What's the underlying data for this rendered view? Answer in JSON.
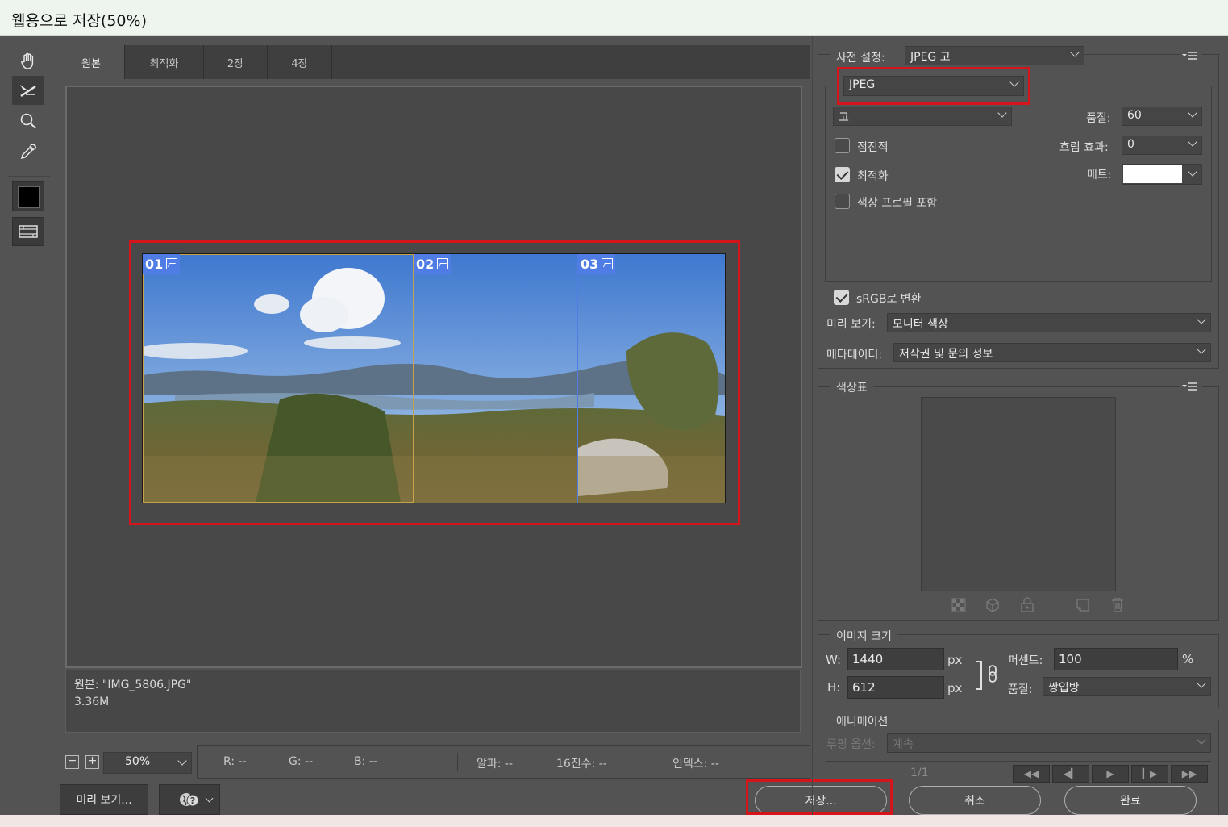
{
  "window": {
    "title": "웹용으로 저장(50%)"
  },
  "toolbar": {
    "tools": [
      "hand-icon",
      "slice-select-icon",
      "zoom-icon",
      "eyedropper-icon"
    ],
    "color_swatch": "#000000"
  },
  "tabs": [
    {
      "label": "원본",
      "active": true
    },
    {
      "label": "최적화"
    },
    {
      "label": "2장"
    },
    {
      "label": "4장"
    }
  ],
  "preview": {
    "slices": [
      {
        "label": "01"
      },
      {
        "label": "02"
      },
      {
        "label": "03"
      }
    ],
    "info_line1": "원본: \"IMG_5806.JPG\"",
    "info_line2": "3.36M"
  },
  "statusbar": {
    "zoom": "50%",
    "r": "R: --",
    "g": "G: --",
    "b": "B: --",
    "alpha": "알파: --",
    "hex": "16진수: --",
    "index": "인덱스: --"
  },
  "bottom": {
    "preview_button": "미리 보기...",
    "save_button": "저장...",
    "cancel_button": "취소",
    "done_button": "완료"
  },
  "settings": {
    "preset_label": "사전 설정:",
    "preset_value": "JPEG 고",
    "format_value": "JPEG",
    "quality_preset": "고",
    "quality_label": "품질:",
    "quality_value": "60",
    "blur_label": "흐림 효과:",
    "blur_value": "0",
    "matte_label": "매트:",
    "matte_color": "#ffffff",
    "progressive_label": "점진적",
    "progressive_checked": false,
    "optimized_label": "최적화",
    "optimized_checked": true,
    "embed_profile_label": "색상 프로필 포함",
    "embed_profile_checked": false,
    "srgb_label": "sRGB로 변환",
    "srgb_checked": true,
    "preview_label": "미리 보기:",
    "preview_value": "모니터 색상",
    "metadata_label": "메타데이터:",
    "metadata_value": "저작권 및 문의 정보"
  },
  "color_table": {
    "title": "색상표"
  },
  "image_size": {
    "title": "이미지 크기",
    "w_label": "W:",
    "w_value": "1440",
    "h_label": "H:",
    "h_value": "612",
    "unit": "px",
    "percent_label": "퍼센트:",
    "percent_value": "100",
    "percent_unit": "%",
    "quality_label": "품질:",
    "quality_value": "쌍입방"
  },
  "animation": {
    "title": "애니메이션",
    "loop_label": "루핑 옵션:",
    "loop_value": "계속",
    "frame_counter": "1/1"
  },
  "highlight_color": "#d5141b",
  "slice_color": "#4f7de5"
}
